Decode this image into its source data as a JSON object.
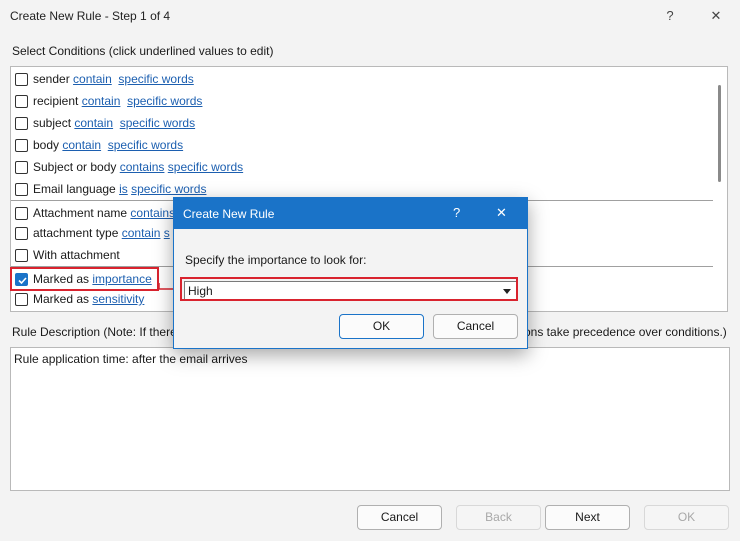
{
  "window": {
    "title": "Create New Rule - Step 1 of 4",
    "help": "?",
    "close": "✕"
  },
  "conditions": {
    "label": "Select Conditions (click underlined values to edit)",
    "rows": [
      {
        "prefix": "sender",
        "op": "contain",
        "val": "specific words",
        "checked": false
      },
      {
        "prefix": "recipient",
        "op": "contain",
        "val": "specific words",
        "checked": false
      },
      {
        "prefix": "subject",
        "op": "contain",
        "val": "specific words",
        "checked": false
      },
      {
        "prefix": "body",
        "op": "contain",
        "val": "specific words",
        "checked": false
      },
      {
        "prefix": "Subject or body",
        "op": "contains",
        "val": "specific words",
        "checked": false
      },
      {
        "prefix": "Email language",
        "op": "is",
        "val": "specific words",
        "checked": false
      },
      {
        "prefix": "Attachment name",
        "op": "contains",
        "val": "",
        "checked": false
      },
      {
        "prefix": "attachment type",
        "op": "contain",
        "val": "s",
        "checked": false
      },
      {
        "prefix": "With attachment",
        "op": "",
        "val": "",
        "checked": false
      },
      {
        "prefix": "Marked as",
        "op": "importance",
        "val": "",
        "checked": true
      },
      {
        "prefix": "Marked as",
        "op": "sensitivity",
        "val": "",
        "checked": false
      }
    ]
  },
  "description": {
    "label_head": "Rule Description (Note: If there",
    "label_tail": "ons take precedence over conditions.)",
    "text": "Rule application time: after the email arrives"
  },
  "footer": {
    "cancel": "Cancel",
    "back": "Back",
    "next": "Next",
    "ok": "OK"
  },
  "dialog": {
    "title": "Create New Rule",
    "help": "?",
    "close": "✕",
    "prompt": "Specify the importance to look for:",
    "selected": "High",
    "ok": "OK",
    "cancel": "Cancel"
  },
  "colors": {
    "accent": "#1a73c8",
    "highlight": "#d9232e",
    "link": "#1c5fb0"
  }
}
